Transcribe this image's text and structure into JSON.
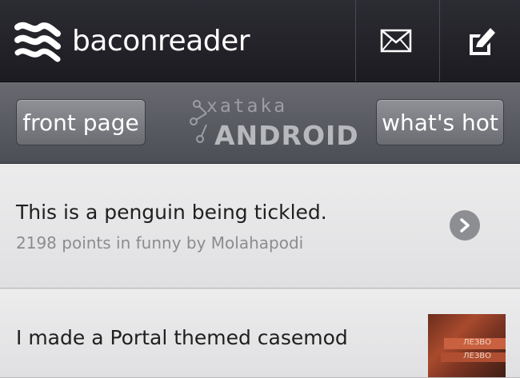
{
  "app": {
    "name": "baconreader",
    "logo_icon": "bacon-logo-icon",
    "mail_icon": "mail-icon",
    "compose_icon": "compose-icon"
  },
  "toolbar": {
    "left_button": "front page",
    "right_button": "what's hot",
    "watermark_top": "xataka",
    "watermark_bottom": "ANDROID"
  },
  "posts": [
    {
      "title": "This is a penguin being tickled.",
      "meta": "2198 points in funny by Molahapodi",
      "action_icon": "chevron-right-icon"
    },
    {
      "title": "I made a Portal themed casemod",
      "thumbnail_label_1": "ЛЕЗВО",
      "thumbnail_label_2": "ЛЕЗВО"
    }
  ],
  "colors": {
    "appbar": "#1f1f25",
    "toolbar": "#5a5c62",
    "list_bg": "#e6e6e8"
  }
}
